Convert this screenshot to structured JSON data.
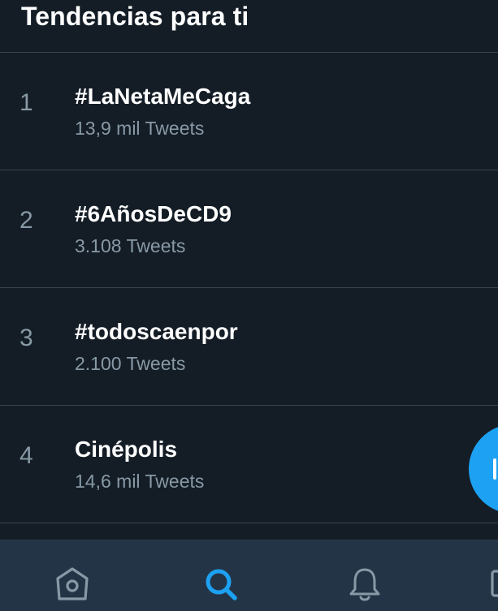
{
  "header": {
    "title": "Tendencias para ti"
  },
  "trends": [
    {
      "rank": "1",
      "name": "#LaNetaMeCaga",
      "count": "13,9 mil Tweets"
    },
    {
      "rank": "2",
      "name": "#6AñosDeCD9",
      "count": "3.108 Tweets"
    },
    {
      "rank": "3",
      "name": "#todoscaenpor",
      "count": "2.100 Tweets"
    },
    {
      "rank": "4",
      "name": "Cinépolis",
      "count": "14,6 mil Tweets"
    }
  ],
  "fab": {
    "icon": "plus-icon",
    "color": "#1da1f2"
  },
  "bottom_nav": {
    "items": [
      {
        "icon": "home-icon",
        "active": false
      },
      {
        "icon": "search-icon",
        "active": true
      },
      {
        "icon": "bell-icon",
        "active": false
      },
      {
        "icon": "mail-icon",
        "active": false
      }
    ],
    "active_color": "#1da1f2",
    "inactive_color": "#8899a6"
  },
  "colors": {
    "background": "#141d26",
    "nav_background": "#243447",
    "divider": "#38444d",
    "primary_text": "#ffffff",
    "secondary_text": "#8899a6"
  }
}
